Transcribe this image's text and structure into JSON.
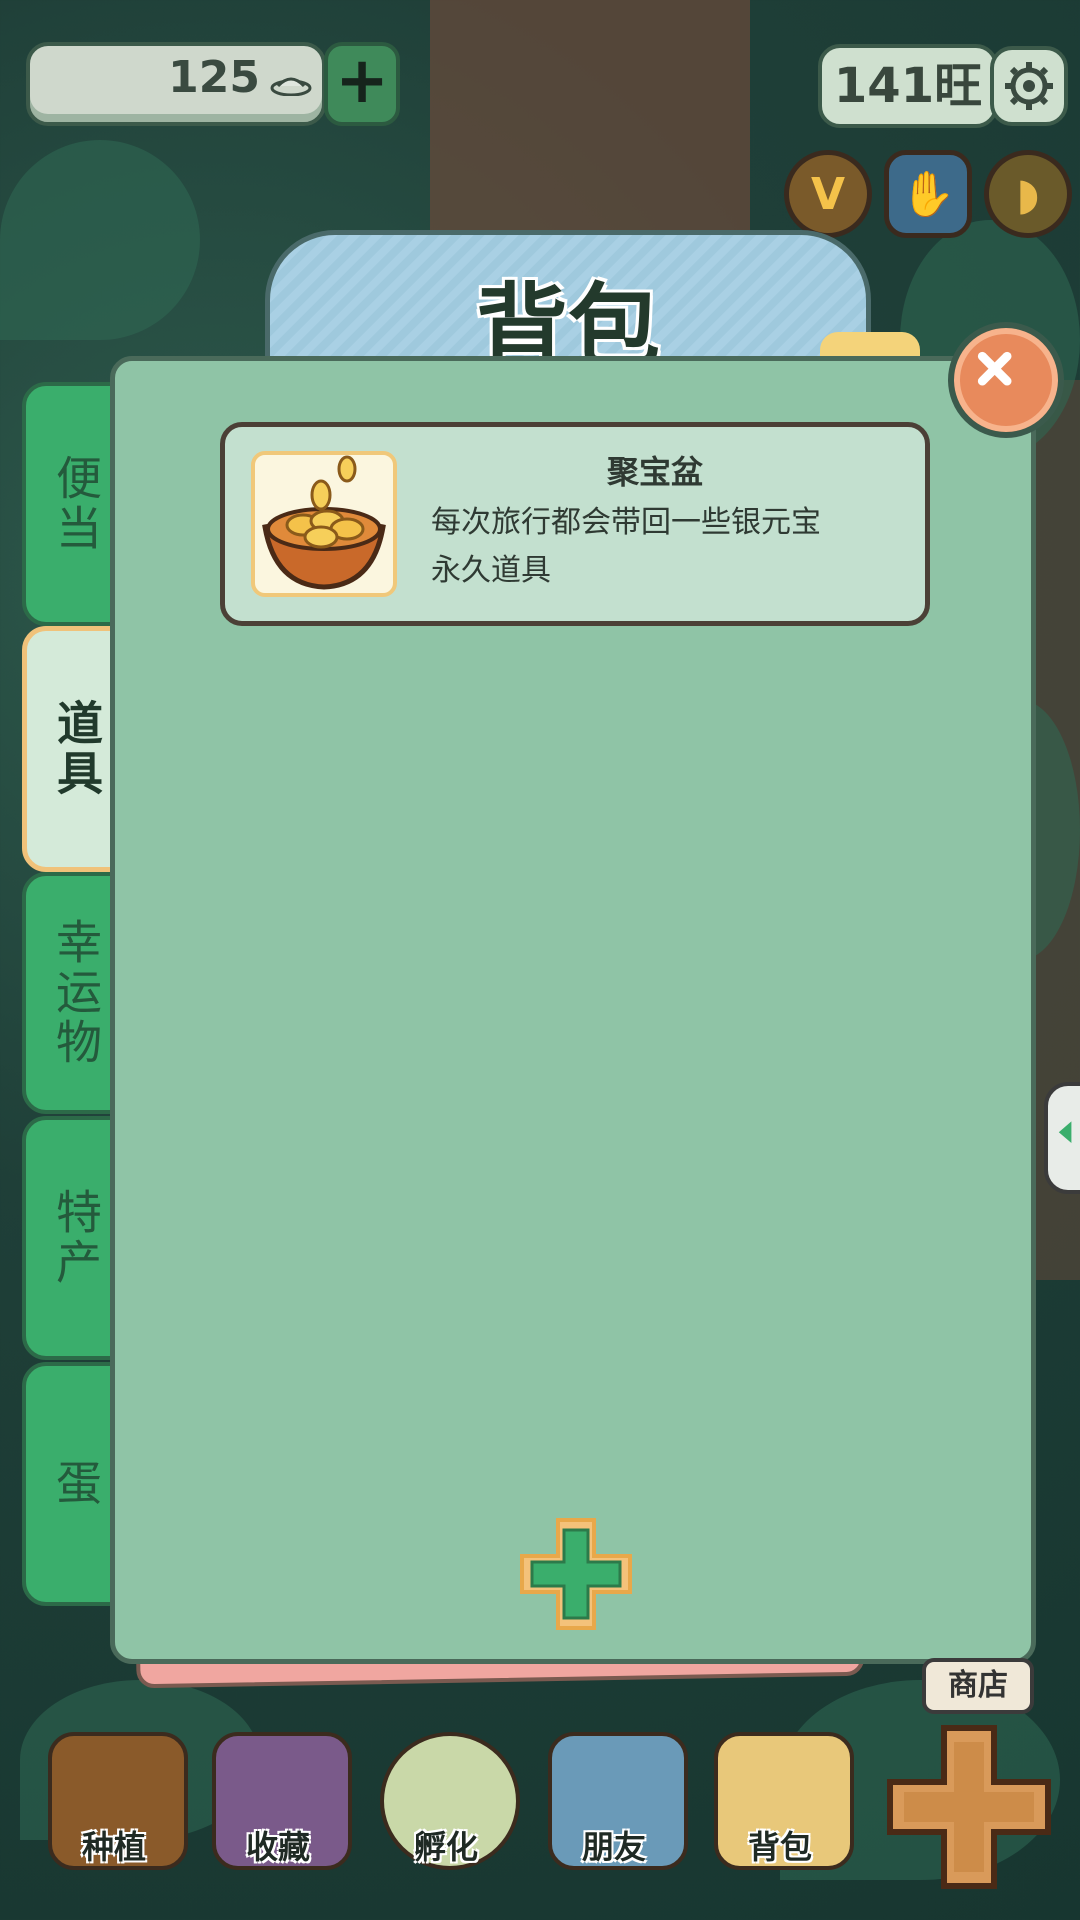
{
  "hud": {
    "currency_value": "125",
    "add_currency_label": "+",
    "wang_value": "141旺"
  },
  "panel": {
    "title": "背包"
  },
  "tabs": [
    {
      "label": "便当",
      "active": false
    },
    {
      "label": "道具",
      "active": true
    },
    {
      "label": "幸运物",
      "active": false
    },
    {
      "label": "特产",
      "active": false
    },
    {
      "label": "蛋",
      "active": false
    }
  ],
  "items": [
    {
      "name": "聚宝盆",
      "description": "每次旅行都会带回一些银元宝",
      "type": "永久道具",
      "icon": "treasure-bowl-icon"
    }
  ],
  "top_icons": [
    {
      "name": "v-icon",
      "glyph": "V"
    },
    {
      "name": "hand-icon",
      "glyph": "✋"
    },
    {
      "name": "ginkgo-icon",
      "glyph": "🍂"
    }
  ],
  "bottom_nav": [
    {
      "label": "种植"
    },
    {
      "label": "收藏"
    },
    {
      "label": "孵化"
    },
    {
      "label": "朋友"
    },
    {
      "label": "背包"
    }
  ],
  "shop_label": "商店",
  "colors": {
    "panel": "#8fc4a6",
    "tab_green": "#3aae6c",
    "title_blue": "#a9d0e4",
    "close_orange": "#e88a5c"
  }
}
